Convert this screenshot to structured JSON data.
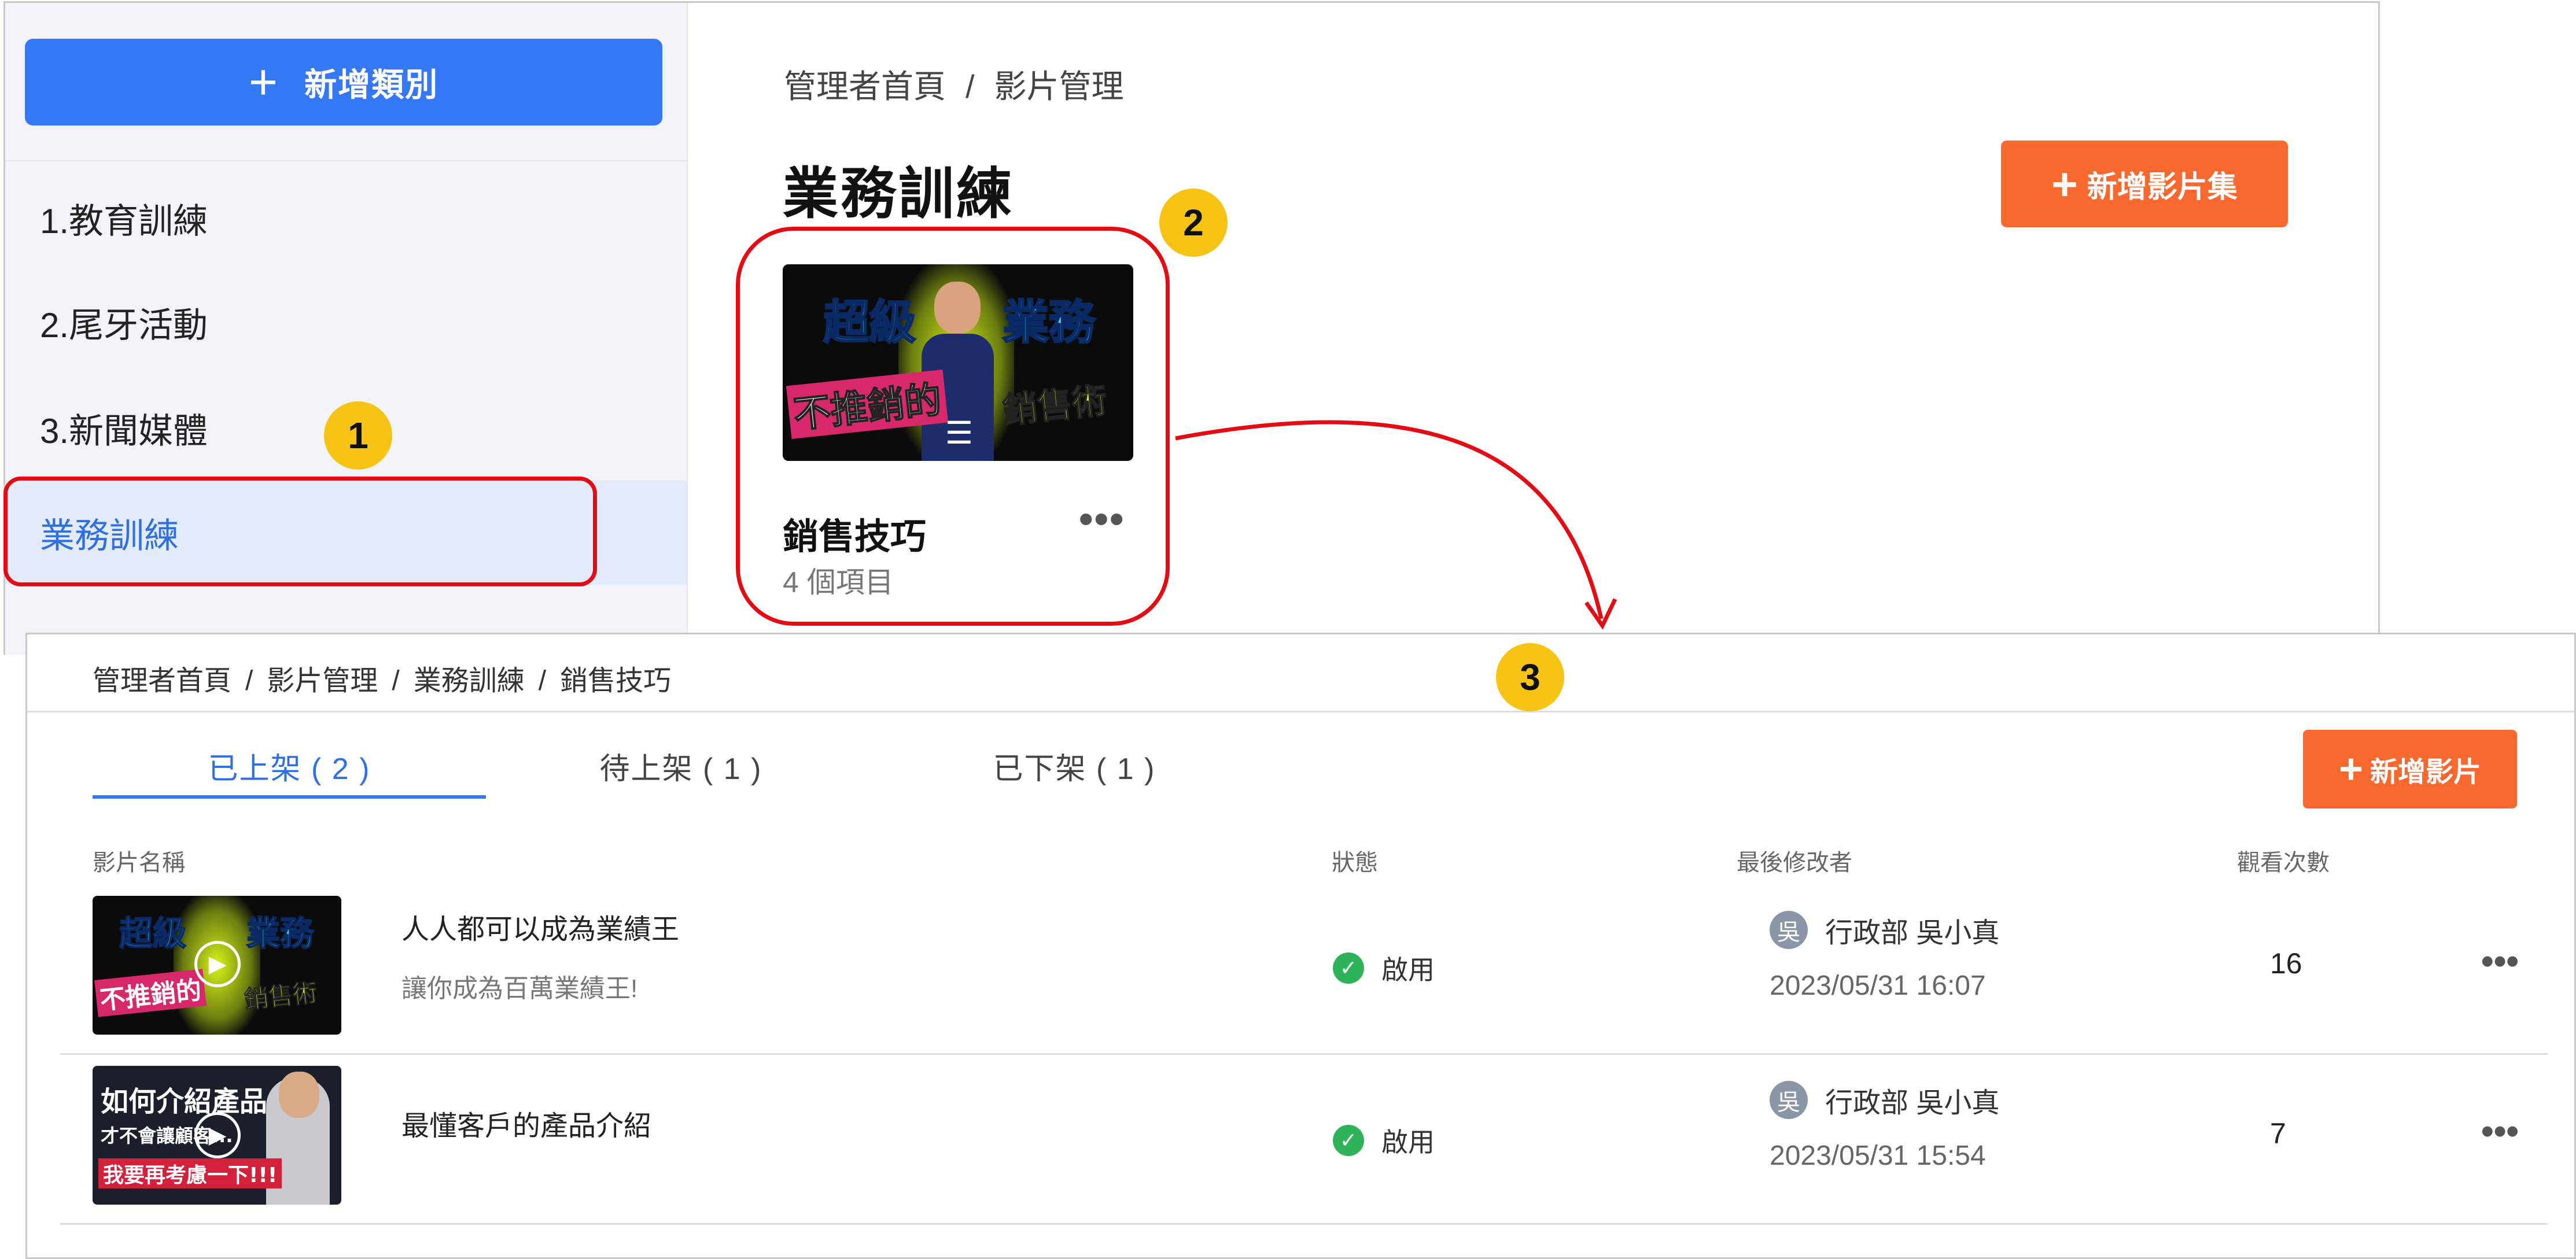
{
  "sidebar": {
    "add_button": "新增類別",
    "items": [
      {
        "label": "1.教育訓練"
      },
      {
        "label": "2.尾牙活動"
      },
      {
        "label": "3.新聞媒體"
      },
      {
        "label": "業務訓練"
      }
    ]
  },
  "top": {
    "breadcrumb": [
      "管理者首頁",
      "影片管理"
    ],
    "title": "業務訓練",
    "add_set_button": "新增影片集",
    "card": {
      "thumb_lines": [
        "超級",
        "業務",
        "不推銷的",
        "銷售術"
      ],
      "name": "銷售技巧",
      "count": "4 個項目"
    }
  },
  "bottom": {
    "breadcrumb": [
      "管理者首頁",
      "影片管理",
      "業務訓練",
      "銷售技巧"
    ],
    "tabs": [
      {
        "label": "已上架 ( 2 )"
      },
      {
        "label": "待上架 ( 1 )"
      },
      {
        "label": "已下架 ( 1 )"
      }
    ],
    "add_video_button": "新增影片",
    "columns": {
      "name": "影片名稱",
      "status": "狀態",
      "editor": "最後修改者",
      "views": "觀看次數"
    },
    "rows": [
      {
        "title": "人人都可以成為業績王",
        "subtitle": "讓你成為百萬業績王!",
        "status": "啟用",
        "editor_avatar": "吳",
        "editor": "行政部 吳小真",
        "time": "2023/05/31 16:07",
        "views": "16",
        "thumb_lines": [
          "超級",
          "業務",
          "不推銷的",
          "銷售術"
        ]
      },
      {
        "title": "最懂客戶的產品介紹",
        "subtitle": "",
        "status": "啟用",
        "editor_avatar": "吳",
        "editor": "行政部 吳小真",
        "time": "2023/05/31 15:54",
        "views": "7",
        "thumb_lines": [
          "如何介紹產品",
          "才不會讓顧客...",
          "我要再考慮一下!!!"
        ]
      }
    ]
  },
  "annotations": [
    "1",
    "2",
    "3"
  ],
  "colors": {
    "primary": "#3478f5",
    "accent": "#f9682f",
    "annotation": "#e30b14",
    "badge": "#f7c314",
    "success": "#2fb35a"
  }
}
